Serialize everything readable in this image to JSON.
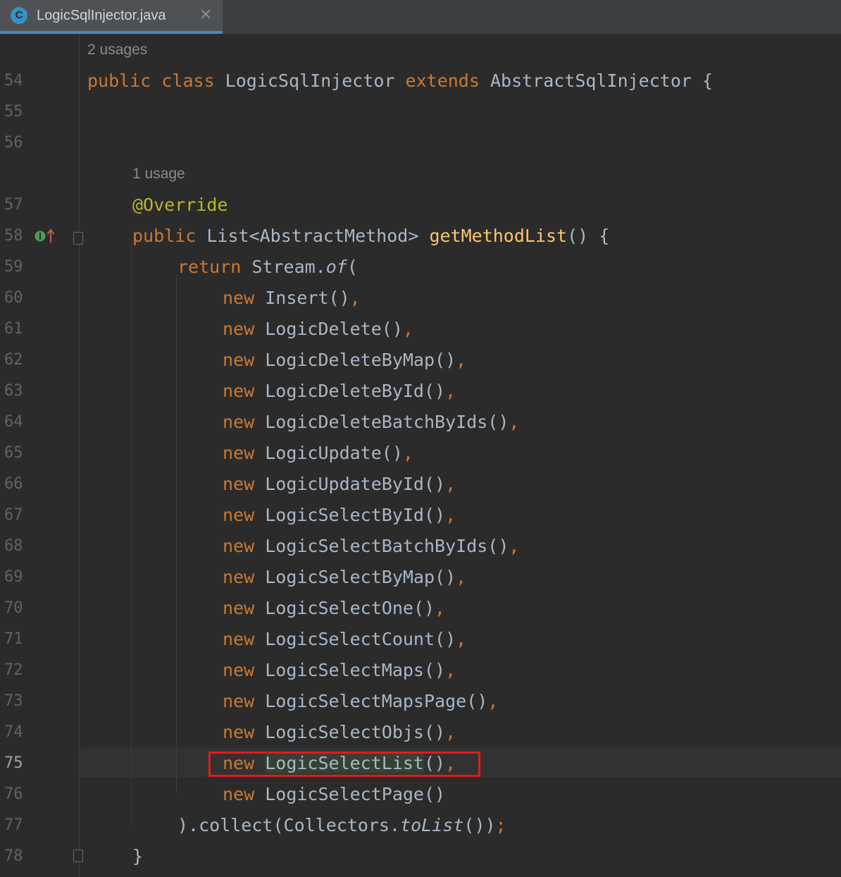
{
  "tab": {
    "icon_letter": "C",
    "title": "LogicSqlInjector.java",
    "close_glyph": "✕"
  },
  "hints": {
    "class_usages": "2 usages",
    "method_usages": "1 usage"
  },
  "line_numbers": [
    "54",
    "55",
    "56",
    "57",
    "58",
    "59",
    "60",
    "61",
    "62",
    "63",
    "64",
    "65",
    "66",
    "67",
    "68",
    "69",
    "70",
    "71",
    "72",
    "73",
    "74",
    "75",
    "76",
    "77",
    "78"
  ],
  "current_line": "75",
  "code": {
    "l54": {
      "kw1": "public class ",
      "name": "LogicSqlInjector ",
      "kw2": "extends ",
      "rest": "AbstractSqlInjector {"
    },
    "l57": {
      "annotation": "@Override"
    },
    "l58": {
      "kw": "public ",
      "type": "List<AbstractMethod> ",
      "fn": "getMethodList",
      "rest": "() {"
    },
    "l59": {
      "kw": "return ",
      "obj": "Stream.",
      "method": "of",
      "paren": "("
    },
    "entries": [
      {
        "kw": "new ",
        "name": "Insert",
        "tail": "()",
        "comma": ","
      },
      {
        "kw": "new ",
        "name": "LogicDelete",
        "tail": "()",
        "comma": ","
      },
      {
        "kw": "new ",
        "name": "LogicDeleteByMap",
        "tail": "()",
        "comma": ","
      },
      {
        "kw": "new ",
        "name": "LogicDeleteById",
        "tail": "()",
        "comma": ","
      },
      {
        "kw": "new ",
        "name": "LogicDeleteBatchByIds",
        "tail": "()",
        "comma": ","
      },
      {
        "kw": "new ",
        "name": "LogicUpdate",
        "tail": "()",
        "comma": ","
      },
      {
        "kw": "new ",
        "name": "LogicUpdateById",
        "tail": "()",
        "comma": ","
      },
      {
        "kw": "new ",
        "name": "LogicSelectById",
        "tail": "()",
        "comma": ","
      },
      {
        "kw": "new ",
        "name": "LogicSelectBatchByIds",
        "tail": "()",
        "comma": ","
      },
      {
        "kw": "new ",
        "name": "LogicSelectByMap",
        "tail": "()",
        "comma": ","
      },
      {
        "kw": "new ",
        "name": "LogicSelectOne",
        "tail": "()",
        "comma": ","
      },
      {
        "kw": "new ",
        "name": "LogicSelectCount",
        "tail": "()",
        "comma": ","
      },
      {
        "kw": "new ",
        "name": "LogicSelectMaps",
        "tail": "()",
        "comma": ","
      },
      {
        "kw": "new ",
        "name": "LogicSelectMapsPage",
        "tail": "()",
        "comma": ","
      },
      {
        "kw": "new ",
        "name": "LogicSelectObjs",
        "tail": "()",
        "comma": ","
      },
      {
        "kw": "new ",
        "name": "LogicSelectList",
        "tail": "()",
        "comma": ","
      },
      {
        "kw": "new ",
        "name": "LogicSelectPage",
        "tail": "()",
        "comma": ""
      }
    ],
    "l77": {
      "a": ").collect(Collectors.",
      "method": "toList",
      "b": "())",
      "semi": ";"
    },
    "l78": {
      "brace": "}"
    }
  },
  "colors": {
    "background": "#2b2b2b",
    "keyword": "#cc7832",
    "annotation": "#bbb529",
    "function": "#ffc66d",
    "identifier": "#a9b7c6",
    "highlight_box": "#e41b1b",
    "tab_underline": "#4a88c7"
  }
}
